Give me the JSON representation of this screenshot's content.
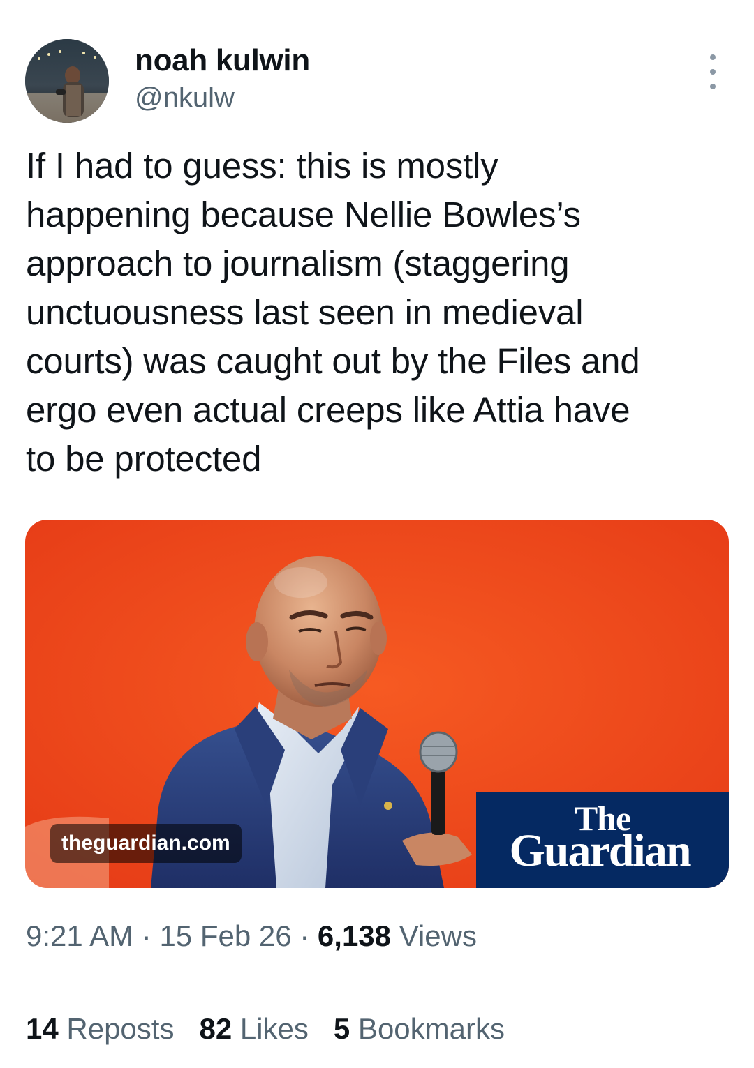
{
  "author": {
    "display_name": "noah kulwin",
    "handle": "@nkulw"
  },
  "tweet": {
    "lines": [
      "If I had to guess: this is mostly",
      "happening because Nellie Bowles’s",
      "approach to journalism (staggering",
      "unctuousness last seen in medieval",
      "courts) was caught out by the Files and",
      "ergo even actual creeps like Attia have",
      "to be protected"
    ]
  },
  "link_card": {
    "domain": "theguardian.com",
    "brand_the": "The",
    "brand_guardian": "Guardian",
    "colors": {
      "background": "#f04a1e",
      "brand_box": "#052962"
    }
  },
  "meta": {
    "time": "9:21 AM",
    "separator": " · ",
    "date": "15 Feb 26",
    "views_count": "6,138",
    "views_label": " Views"
  },
  "stats": {
    "reposts_count": "14",
    "reposts_label": " Reposts",
    "likes_count": "82",
    "likes_label": " Likes",
    "bookmarks_count": "5",
    "bookmarks_label": " Bookmarks"
  },
  "icons": {
    "more": "more-vertical-icon"
  }
}
